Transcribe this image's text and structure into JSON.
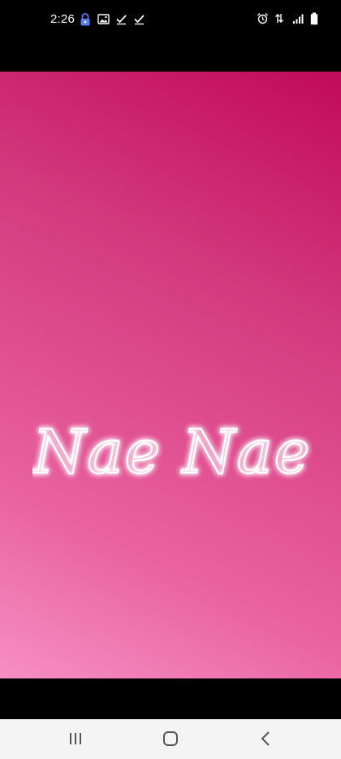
{
  "status_bar": {
    "time": "2:26",
    "left_icons": [
      "lock-icon",
      "image-icon",
      "check-icon",
      "check-icon"
    ],
    "right_icons": [
      "alarm-icon",
      "data-transfer-icon",
      "signal-icon",
      "battery-icon"
    ]
  },
  "splash": {
    "logo_text": "Nae Nae",
    "gradient_colors": [
      "#c10a5a",
      "#d43a7f",
      "#e9629f",
      "#f68fc4"
    ]
  },
  "nav_bar": {
    "buttons": [
      {
        "name": "recent-apps",
        "icon": "recent-apps-icon"
      },
      {
        "name": "home",
        "icon": "home-icon"
      },
      {
        "name": "back",
        "icon": "back-icon"
      }
    ]
  },
  "colors": {
    "status_bar_bg": "#000000",
    "nav_bar_bg": "#f4f4f4",
    "lock_accent": "#5b7bf0"
  }
}
